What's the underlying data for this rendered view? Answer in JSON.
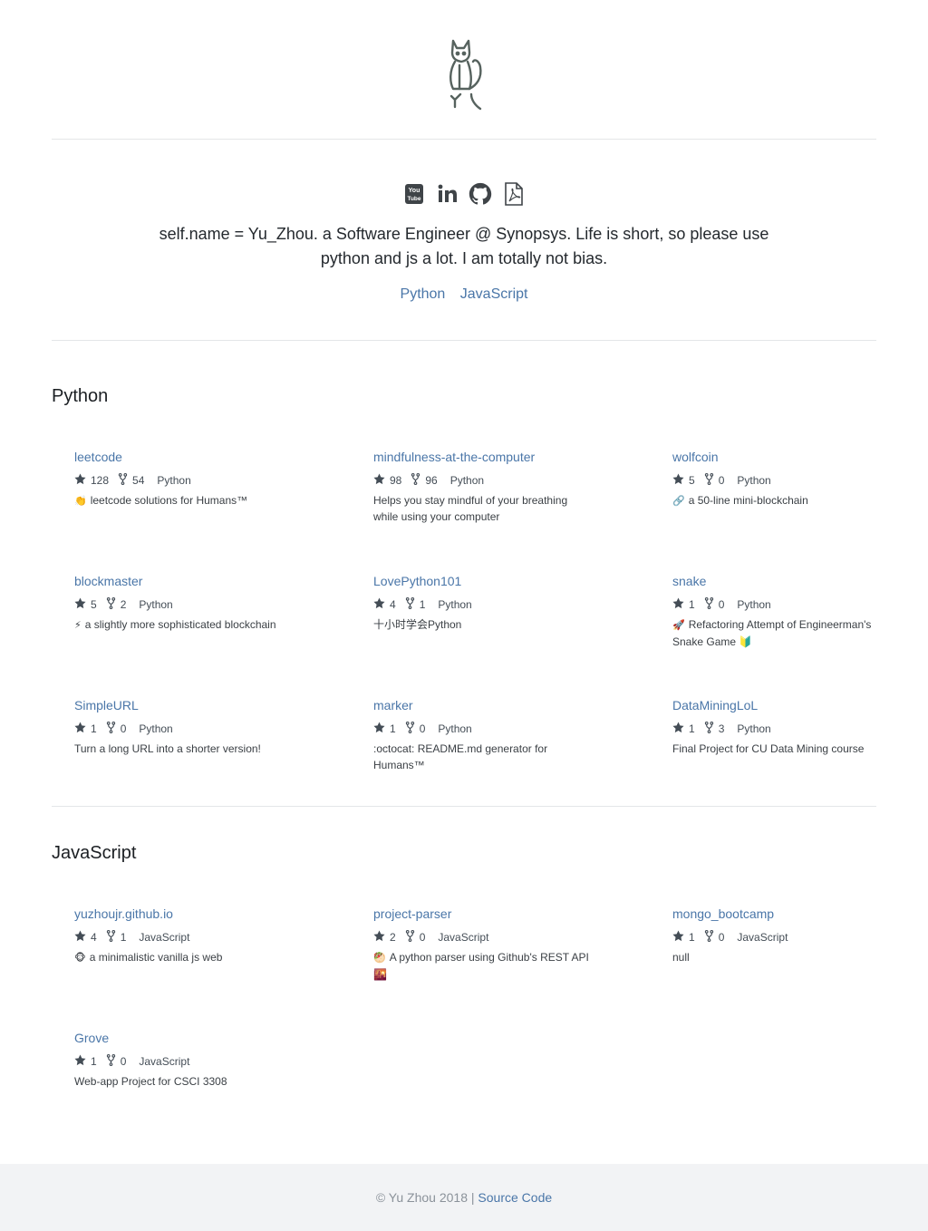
{
  "header": {
    "logo_icon": "cat-logo-icon"
  },
  "profile": {
    "social_icons": [
      "youtube-icon",
      "linkedin-icon",
      "github-icon",
      "pdf-icon"
    ],
    "bio": "self.name = Yu_Zhou. a Software Engineer @ Synopsys. Life is short, so please use python and js a lot. I am totally not bias.",
    "language_links": [
      "Python",
      "JavaScript"
    ]
  },
  "sections": [
    {
      "title": "Python",
      "repos": [
        {
          "name": "leetcode",
          "stars": "128",
          "forks": "54",
          "language": "Python",
          "emoji": "👏",
          "description": "leetcode solutions for Humans™"
        },
        {
          "name": "mindfulness-at-the-computer",
          "stars": "98",
          "forks": "96",
          "language": "Python",
          "emoji": "",
          "description": "Helps you stay mindful of your breathing while using your computer"
        },
        {
          "name": "wolfcoin",
          "stars": "5",
          "forks": "0",
          "language": "Python",
          "emoji": "🔗",
          "description": "a 50-line mini-blockchain"
        },
        {
          "name": "blockmaster",
          "stars": "5",
          "forks": "2",
          "language": "Python",
          "emoji": "⚡",
          "description": "a slightly more sophisticated blockchain"
        },
        {
          "name": "LovePython101",
          "stars": "4",
          "forks": "1",
          "language": "Python",
          "emoji": "",
          "description": "十小时学会Python"
        },
        {
          "name": "snake",
          "stars": "1",
          "forks": "0",
          "language": "Python",
          "emoji": "🚀",
          "description": "Refactoring Attempt of Engineerman's Snake Game 🔰"
        },
        {
          "name": "SimpleURL",
          "stars": "1",
          "forks": "0",
          "language": "Python",
          "emoji": "",
          "description": "Turn a long URL into a shorter version!"
        },
        {
          "name": "marker",
          "stars": "1",
          "forks": "0",
          "language": "Python",
          "emoji": "",
          "description": ":octocat: README.md generator for Humans™"
        },
        {
          "name": "DataMiningLoL",
          "stars": "1",
          "forks": "3",
          "language": "Python",
          "emoji": "",
          "description": "Final Project for CU Data Mining course"
        }
      ]
    },
    {
      "title": "JavaScript",
      "repos": [
        {
          "name": "yuzhoujr.github.io",
          "stars": "4",
          "forks": "1",
          "language": "JavaScript",
          "emoji": "🐵",
          "description": "a minimalistic vanilla js web"
        },
        {
          "name": "project-parser",
          "stars": "2",
          "forks": "0",
          "language": "JavaScript",
          "emoji": "🥙",
          "description": "A python parser using Github's REST API 🌇"
        },
        {
          "name": "mongo_bootcamp",
          "stars": "1",
          "forks": "0",
          "language": "JavaScript",
          "emoji": "",
          "description": "null"
        },
        {
          "name": "Grove",
          "stars": "1",
          "forks": "0",
          "language": "JavaScript",
          "emoji": "",
          "description": "Web-app Project for CSCI 3308"
        }
      ]
    }
  ],
  "footer": {
    "copyright": "© Yu Zhou 2018 |",
    "link": "Source Code"
  },
  "colors": {
    "link": "#4a76a8",
    "text": "#24292e",
    "divider": "#e4e6e8",
    "footer_bg": "#f2f3f5"
  }
}
